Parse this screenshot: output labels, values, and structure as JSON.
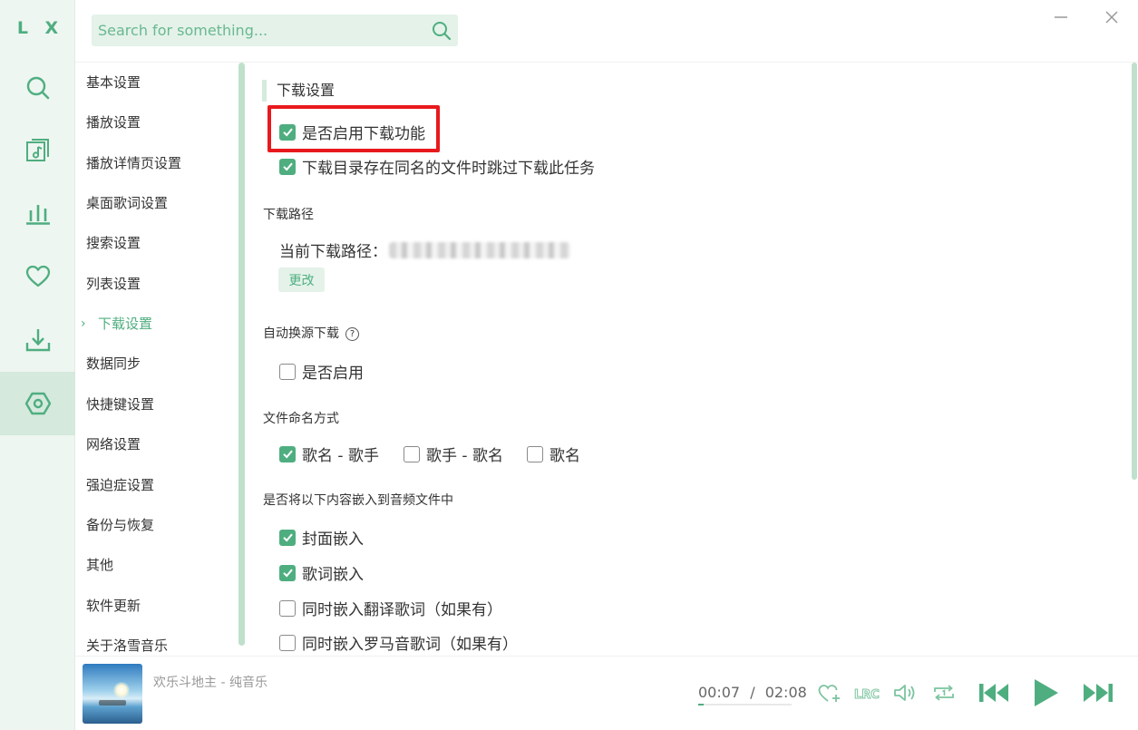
{
  "app": {
    "logo": "L X"
  },
  "search": {
    "placeholder": "Search for something..."
  },
  "nav": {
    "items": [
      {
        "label": "基本设置"
      },
      {
        "label": "播放设置"
      },
      {
        "label": "播放详情页设置"
      },
      {
        "label": "桌面歌词设置"
      },
      {
        "label": "搜索设置"
      },
      {
        "label": "列表设置"
      },
      {
        "label": "下载设置",
        "active": true
      },
      {
        "label": "数据同步"
      },
      {
        "label": "快捷键设置"
      },
      {
        "label": "网络设置"
      },
      {
        "label": "强迫症设置"
      },
      {
        "label": "备份与恢复"
      },
      {
        "label": "其他"
      },
      {
        "label": "软件更新"
      },
      {
        "label": "关于洛雪音乐"
      }
    ]
  },
  "content": {
    "title": "下载设置",
    "enable_download": {
      "label": "是否启用下载功能",
      "checked": true
    },
    "skip_existing": {
      "label": "下载目录存在同名的文件时跳过下载此任务",
      "checked": true
    },
    "path": {
      "group_label": "下载路径",
      "current_label": "当前下载路径：",
      "change_button": "更改"
    },
    "auto_switch": {
      "group_label": "自动换源下载",
      "help_icon": "?",
      "enable": {
        "label": "是否启用",
        "checked": false
      }
    },
    "naming": {
      "group_label": "文件命名方式",
      "options": [
        {
          "label": "歌名 - 歌手",
          "checked": true
        },
        {
          "label": "歌手 - 歌名",
          "checked": false
        },
        {
          "label": "歌名",
          "checked": false
        }
      ]
    },
    "embed": {
      "group_label": "是否将以下内容嵌入到音频文件中",
      "options": [
        {
          "label": "封面嵌入",
          "checked": true
        },
        {
          "label": "歌词嵌入",
          "checked": true
        },
        {
          "label": "同时嵌入翻译歌词（如果有）",
          "checked": false
        },
        {
          "label": "同时嵌入罗马音歌词（如果有）",
          "checked": false
        }
      ]
    }
  },
  "player": {
    "song": "欢乐斗地主 - 纯音乐",
    "current_time": "00:07",
    "separator": "/",
    "total_time": "02:08",
    "progress": 0.055,
    "lrc_label": "LRC"
  },
  "colors": {
    "accent": "#4fae80",
    "accent_light": "#e4f2e9",
    "highlight_box": "#e8191d"
  }
}
